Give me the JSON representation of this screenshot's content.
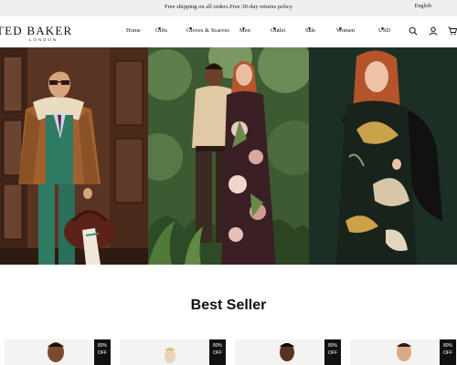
{
  "announcement": {
    "promo": "Free shipping on all orders.Free 30-day returns policy",
    "language": "English"
  },
  "header": {
    "logo_name": "TED BAKER",
    "logo_sub": "LONDON",
    "nav": [
      {
        "label": "Home"
      },
      {
        "label": "Gifts"
      },
      {
        "label": "Gloves & Scarves"
      },
      {
        "label": "Men"
      },
      {
        "label": "Outlet"
      },
      {
        "label": "Sale"
      },
      {
        "label": "Women"
      }
    ],
    "currency": "USD",
    "icons": [
      "search-icon",
      "account-icon",
      "cart-icon"
    ]
  },
  "hero": {
    "panels": [
      "menswear-panel",
      "couple-panel",
      "womenswear-panel"
    ]
  },
  "best_seller": {
    "title": "Best Seller",
    "badges": [
      {
        "line1": "80%",
        "line2": "OFF"
      },
      {
        "line1": "80%",
        "line2": "OFF"
      },
      {
        "line1": "80%",
        "line2": "OFF"
      },
      {
        "line1": "80%",
        "line2": "OFF"
      }
    ]
  }
}
